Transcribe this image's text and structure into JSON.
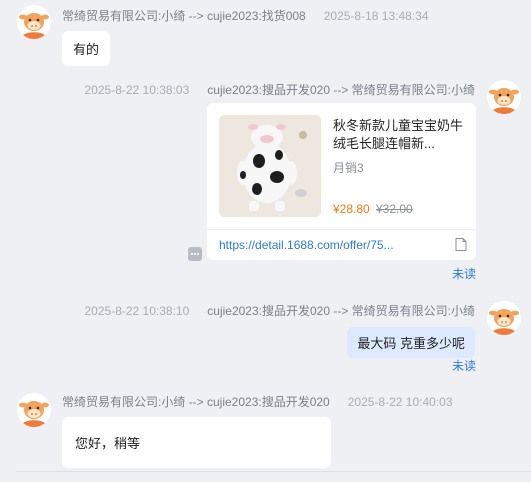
{
  "messages": [
    {
      "sender": "常绮贸易有限公司:小绮 --> cujie2023:找货008",
      "time": "2025-8-18 13:48:34",
      "text": "有的"
    },
    {
      "sender": "cujie2023:搜品开发020 --> 常绮贸易有限公司:小绮",
      "time": "2025-8-22 10:38:03",
      "product": {
        "title": "秋冬新款儿童宝宝奶牛绒毛长腿连帽新...",
        "sales": "月销3",
        "price": "¥28.80",
        "old_price": "¥32.00",
        "link": "https://detail.1688.com/offer/75..."
      },
      "status": "未读"
    },
    {
      "sender": "cujie2023:搜品开发020 --> 常绮贸易有限公司:小绮",
      "time": "2025-8-22 10:38:10",
      "text": "最大码 克重多少呢",
      "status": "未读"
    },
    {
      "sender": "常绮贸易有限公司:小绮 --> cujie2023:搜品开发020",
      "time": "2025-8-22 10:40:03",
      "text": "您好，稍等"
    }
  ],
  "colors": {
    "background": "#eff0f4",
    "bubble_self": "#dce9ff",
    "bubble_other": "#ffffff",
    "unread": "#2b7cd3",
    "price": "#f07a14",
    "link": "#2b7cd3"
  },
  "icons": {
    "avatar": "cow-avatar-icon",
    "more": "more-icon",
    "doc": "document-icon"
  }
}
